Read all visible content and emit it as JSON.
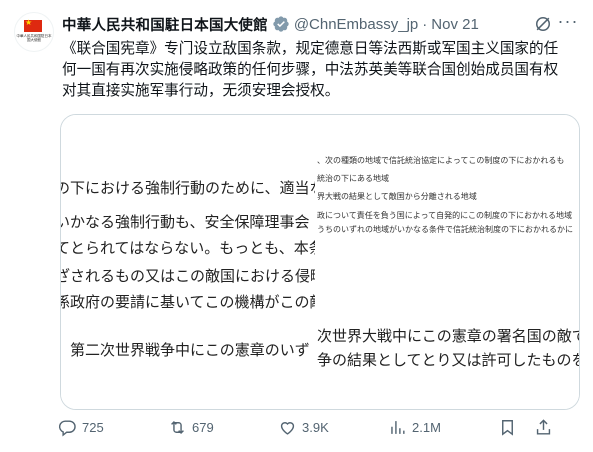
{
  "account": {
    "name": "中華人民共和国駐日本国大使館",
    "handle": "@ChnEmbassy_jp",
    "separator": "·",
    "date": "Nov 21",
    "avatar_text": "中華人民共和国駐日本国大使館"
  },
  "tweet": {
    "lines": [
      "《联合国宪章》专门设立敌国条款，规定德意日等法西斯或军国主义国家的任",
      "何一国有再次实施侵略政策的任何步骤，中法苏英美等联合国创始成员国有权",
      "对其直接实施军事行动，无须安理会授权。"
    ]
  },
  "media": {
    "left_lines": [
      "の下における強制行動のために、適当な",
      "いかなる強制行動も、安全保障理事会",
      "てとられてはならない。もっとも、本条",
      "ざされるもの又はこの敵国における侵略",
      "係政府の要請に基いてこの機構がこの敵",
      "、第二次世界戦争中にこの憲章のいず"
    ],
    "right_small_lines": [
      "、次の種類の地域で信託統治協定によってこの制度の下におかれるも",
      "統治の下にある地域",
      "界大戦の結果として敵国から分離される地域",
      "政について責任を負う国によって自発的にこの制度の下におかれる地域",
      "うちのいずれの地域がいかなる条件で信託統治制度の下におかれるかに"
    ],
    "right_big_lines": [
      "次世界大戦中にこの憲章の署名国の敵であ",
      "争の結果としてとり又は許可したものを無"
    ]
  },
  "actions": {
    "replies": "725",
    "reposts": "679",
    "likes": "3.9K",
    "views": "2.1M"
  },
  "colors": {
    "accent": "#1d9bf0",
    "muted": "#536471",
    "text": "#0f1419",
    "flag_red": "#de2910",
    "flag_star": "#ffde00"
  },
  "icons": [
    "verified-badge-icon",
    "grok-icon",
    "more-icon",
    "reply-icon",
    "repost-icon",
    "like-icon",
    "views-icon",
    "bookmark-icon",
    "share-icon"
  ]
}
